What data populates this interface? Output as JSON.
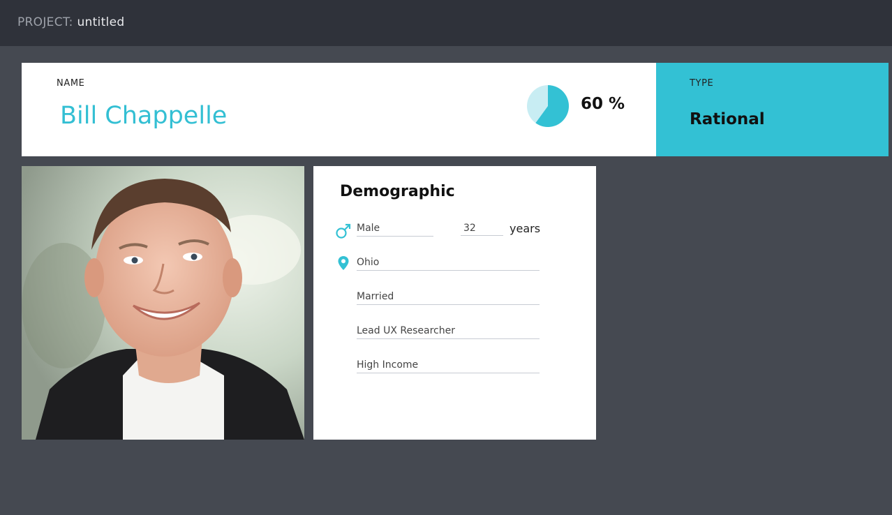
{
  "topbar": {
    "project_prefix": "PROJECT:",
    "project_name": "untitled"
  },
  "persona": {
    "name_label": "NAME",
    "name": "Bill Chappelle",
    "progress_percent": 60,
    "progress_text": "60 %",
    "type_label": "TYPE",
    "type": "Rational"
  },
  "demographic": {
    "title": "Demographic",
    "gender": "Male",
    "age": "32",
    "age_unit": "years",
    "location": "Ohio",
    "marital_status": "Married",
    "occupation": "Lead UX Researcher",
    "income": "High Income"
  },
  "icons": {
    "gender": "male-icon",
    "location": "location-pin-icon"
  },
  "colors": {
    "accent": "#33c1d4",
    "background": "#454951",
    "topbar": "#2f323a"
  }
}
